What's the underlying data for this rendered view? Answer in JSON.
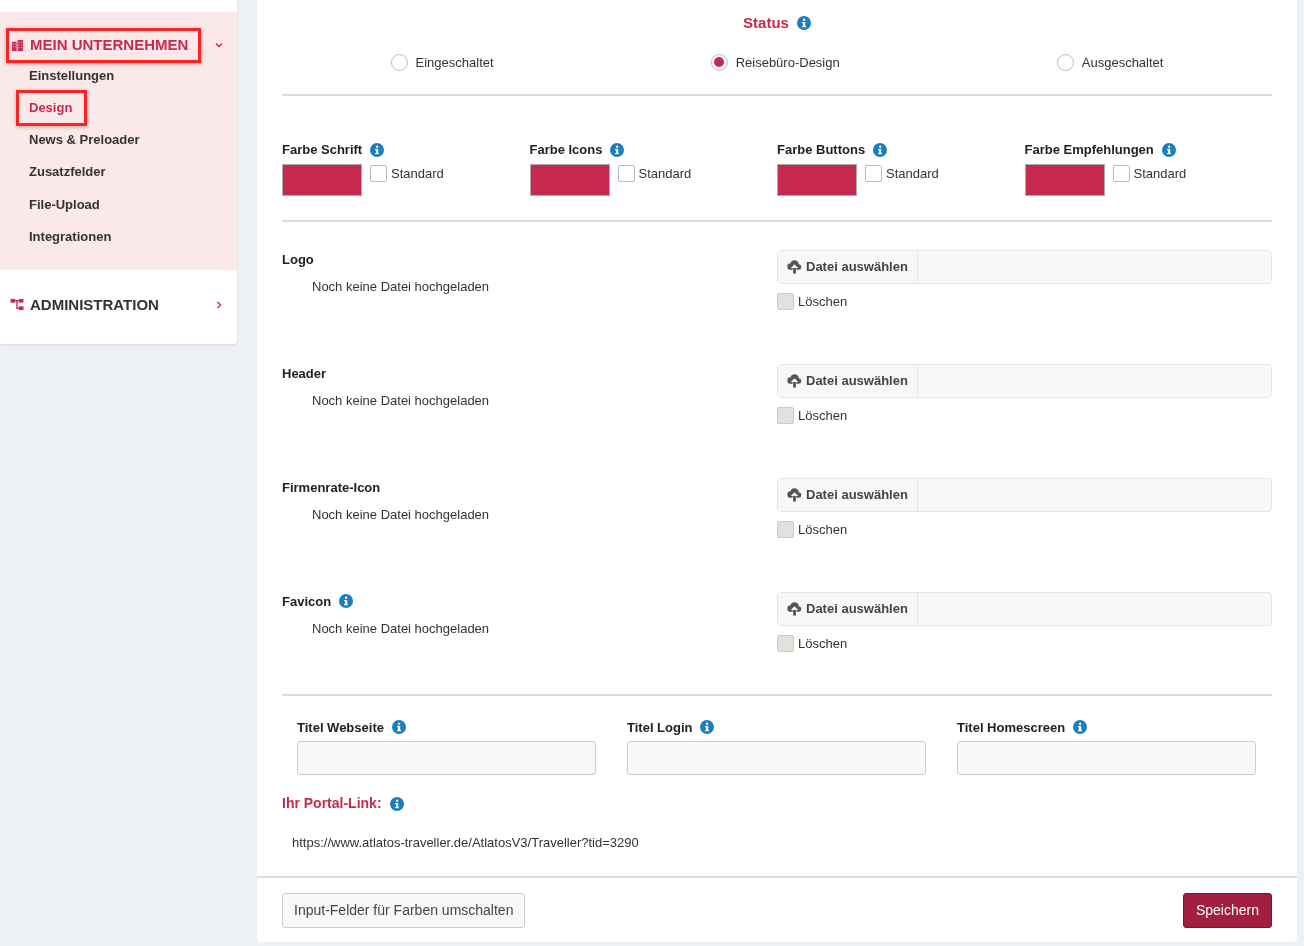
{
  "sidebar": {
    "groups": [
      {
        "label": "MEIN UNTERNEHMEN",
        "expanded": true,
        "highlighted": true,
        "items": [
          {
            "label": "Einstellungen",
            "selected": false,
            "highlighted": false
          },
          {
            "label": "Design",
            "selected": true,
            "highlighted": true
          },
          {
            "label": "News & Preloader",
            "selected": false,
            "highlighted": false
          },
          {
            "label": "Zusatzfelder",
            "selected": false,
            "highlighted": false
          },
          {
            "label": "File-Upload",
            "selected": false,
            "highlighted": false
          },
          {
            "label": "Integrationen",
            "selected": false,
            "highlighted": false
          }
        ]
      },
      {
        "label": "ADMINISTRATION",
        "expanded": false,
        "highlighted": false
      }
    ]
  },
  "status": {
    "title": "Status",
    "options": [
      {
        "label": "Eingeschaltet",
        "selected": false
      },
      {
        "label": "Reisebüro-Design",
        "selected": true
      },
      {
        "label": "Ausgeschaltet",
        "selected": false
      }
    ]
  },
  "colors": [
    {
      "label": "Farbe Schrift",
      "color": "#c8294f",
      "standard_label": "Standard",
      "checked": false
    },
    {
      "label": "Farbe Icons",
      "color": "#c8294f",
      "standard_label": "Standard",
      "checked": false
    },
    {
      "label": "Farbe Buttons",
      "color": "#c8294f",
      "standard_label": "Standard",
      "checked": false
    },
    {
      "label": "Farbe Empfehlungen",
      "color": "#c8294f",
      "standard_label": "Standard",
      "checked": false
    }
  ],
  "uploads": [
    {
      "label": "Logo",
      "info": false,
      "note": "Noch keine Datei hochgeladen",
      "button": "Datei auswählen",
      "delete_label": "Löschen",
      "delete_checked": false,
      "delete_disabled": true
    },
    {
      "label": "Header",
      "info": false,
      "note": "Noch keine Datei hochgeladen",
      "button": "Datei auswählen",
      "delete_label": "Löschen",
      "delete_checked": false,
      "delete_disabled": true
    },
    {
      "label": "Firmenrate-Icon",
      "info": false,
      "note": "Noch keine Datei hochgeladen",
      "button": "Datei auswählen",
      "delete_label": "Löschen",
      "delete_checked": false,
      "delete_disabled": true
    },
    {
      "label": "Favicon",
      "info": true,
      "note": "Noch keine Datei hochgeladen",
      "button": "Datei auswählen",
      "delete_label": "Löschen",
      "delete_checked": false,
      "delete_disabled": true
    }
  ],
  "titles": [
    {
      "label": "Titel Webseite"
    },
    {
      "label": "Titel Login"
    },
    {
      "label": "Titel Homescreen"
    }
  ],
  "portal_link": {
    "label": "Ihr Portal-Link:",
    "url": "https://www.atlatos-traveller.de/AtlatosV3/Traveller?tid=3290"
  },
  "buttons": {
    "toggle": "Input-Felder für Farben umschalten",
    "save": "Speichern"
  }
}
